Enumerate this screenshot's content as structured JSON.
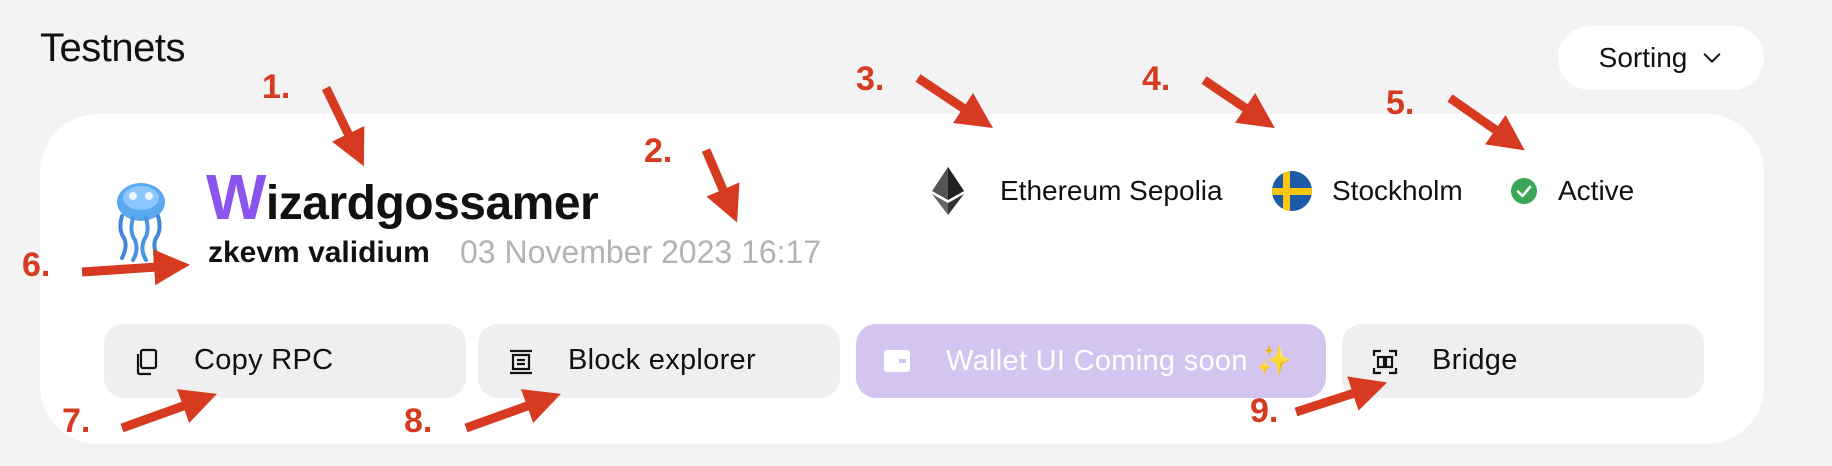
{
  "page": {
    "title": "Testnets"
  },
  "sorting": {
    "label": "Sorting"
  },
  "card": {
    "name_first": "W",
    "name_rest": "izardgossamer",
    "stack_type": "zkevm validium",
    "created": "03 November 2023 16:17",
    "network": "Ethereum Sepolia",
    "location": "Stockholm",
    "status": "Active",
    "avatar_icon": "jellyfish-icon",
    "status_color": "#3aa657",
    "brand_color": "#8a55ee"
  },
  "actions": [
    {
      "label": "Copy RPC",
      "icon": "copy-icon"
    },
    {
      "label": "Block explorer",
      "icon": "block-explorer-icon"
    },
    {
      "label": "Wallet UI Coming soon ✨",
      "icon": "wallet-icon"
    },
    {
      "label": "Bridge",
      "icon": "bridge-icon"
    }
  ],
  "annotations": [
    "1.",
    "2.",
    "3.",
    "4.",
    "5.",
    "6.",
    "7.",
    "8.",
    "9."
  ]
}
